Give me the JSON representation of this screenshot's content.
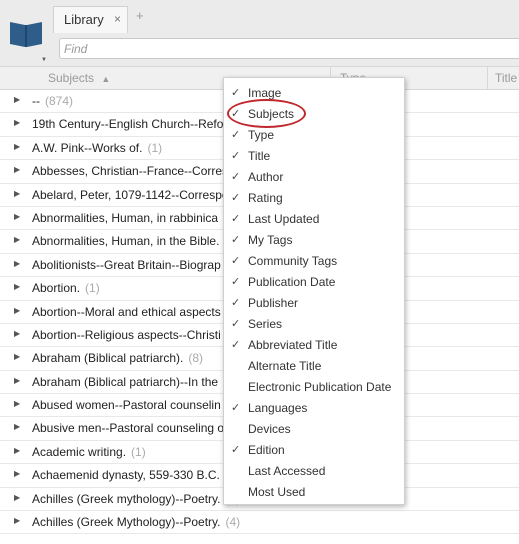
{
  "tabs": [
    {
      "label": "Library",
      "close": "×"
    }
  ],
  "new_tab": "+",
  "search": {
    "placeholder": "Find",
    "value": ""
  },
  "columns": [
    {
      "label": "Subjects",
      "sort": "▲"
    },
    {
      "label": "Type"
    },
    {
      "label": "Title"
    }
  ],
  "rows": [
    {
      "subject": "--",
      "count": "(874)"
    },
    {
      "subject": "19th Century--English Church--Refo",
      "count": ""
    },
    {
      "subject": "A.W. Pink--Works of.",
      "count": "(1)"
    },
    {
      "subject": "Abbesses, Christian--France--Corres",
      "count": ""
    },
    {
      "subject": "Abelard, Peter, 1079-1142--Correspo",
      "count": ""
    },
    {
      "subject": "Abnormalities, Human, in rabbinica",
      "count": ""
    },
    {
      "subject": "Abnormalities, Human, in the Bible.",
      "count": ""
    },
    {
      "subject": "Abolitionists--Great Britain--Biograp",
      "count": ""
    },
    {
      "subject": "Abortion.",
      "count": "(1)"
    },
    {
      "subject": "Abortion--Moral and ethical aspects",
      "count": ""
    },
    {
      "subject": "Abortion--Religious aspects--Christi",
      "count": ""
    },
    {
      "subject": "Abraham (Biblical patriarch).",
      "count": "(8)"
    },
    {
      "subject": "Abraham (Biblical patriarch)--In the",
      "count": ""
    },
    {
      "subject": "Abused women--Pastoral counselin",
      "count": ""
    },
    {
      "subject": "Abusive men--Pastoral counseling o",
      "count": ""
    },
    {
      "subject": "Academic writing.",
      "count": "(1)"
    },
    {
      "subject": "Achaemenid dynasty, 559-330 B.C.",
      "count": ""
    },
    {
      "subject": "Achilles (Greek mythology)--Poetry.",
      "count": "(1)"
    },
    {
      "subject": "Achilles (Greek Mythology)--Poetry.",
      "count": "(4)"
    }
  ],
  "column_menu": [
    {
      "label": "Image",
      "checked": true
    },
    {
      "label": "Subjects",
      "checked": true
    },
    {
      "label": "Type",
      "checked": true
    },
    {
      "label": "Title",
      "checked": true
    },
    {
      "label": "Author",
      "checked": true
    },
    {
      "label": "Rating",
      "checked": true
    },
    {
      "label": "Last Updated",
      "checked": true
    },
    {
      "label": "My Tags",
      "checked": true
    },
    {
      "label": "Community Tags",
      "checked": true
    },
    {
      "label": "Publication Date",
      "checked": true
    },
    {
      "label": "Publisher",
      "checked": true
    },
    {
      "label": "Series",
      "checked": true
    },
    {
      "label": "Abbreviated Title",
      "checked": true
    },
    {
      "label": "Alternate Title",
      "checked": false
    },
    {
      "label": "Electronic Publication Date",
      "checked": false
    },
    {
      "label": "Languages",
      "checked": true
    },
    {
      "label": "Devices",
      "checked": false
    },
    {
      "label": "Edition",
      "checked": true
    },
    {
      "label": "Last Accessed",
      "checked": false
    },
    {
      "label": "Most Used",
      "checked": false
    }
  ],
  "check_glyph": "✓",
  "expand_glyph": "▶",
  "colors": {
    "accent": "#2f5d8a",
    "highlight": "#c0282d"
  }
}
